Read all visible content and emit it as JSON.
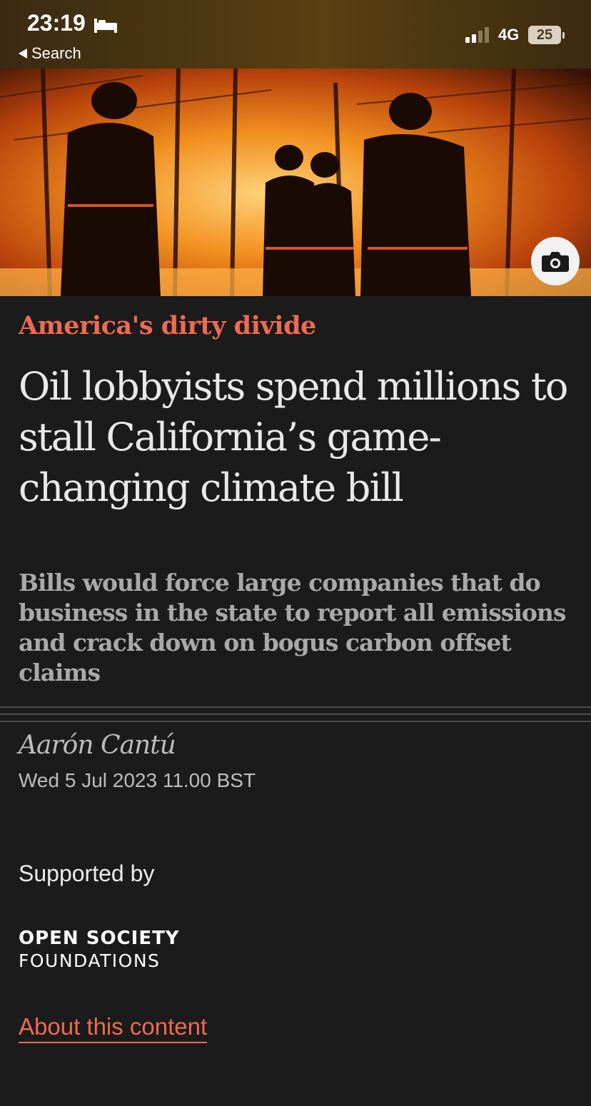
{
  "status_bar": {
    "time": "23:19",
    "back_label": "Search",
    "network": "4G",
    "battery": "25",
    "icons": [
      "bed-icon",
      "signal-icon",
      "battery-icon"
    ]
  },
  "hero": {
    "photo_subject": "firefighters-wildfire-photo",
    "caption_button_icon": "camera-icon"
  },
  "article": {
    "kicker": "America's dirty divide",
    "headline": "Oil lobbyists spend millions to stall California’s game-changing climate bill",
    "standfirst": "Bills would force large companies that do business in the state to report all emissions and crack down on bogus carbon offset claims",
    "byline": "Aarón Cantú",
    "dateline": "Wed 5 Jul 2023 11.00 BST"
  },
  "sponsor": {
    "label": "Supported by",
    "logo_line1": "OPEN SOCIETY",
    "logo_line2": "FOUNDATIONS",
    "about_link": "About this content"
  },
  "colors": {
    "background": "#1b1b1b",
    "accent": "#ee6a52",
    "headline": "#e9e9e9",
    "standfirst": "#a9a9a9"
  }
}
